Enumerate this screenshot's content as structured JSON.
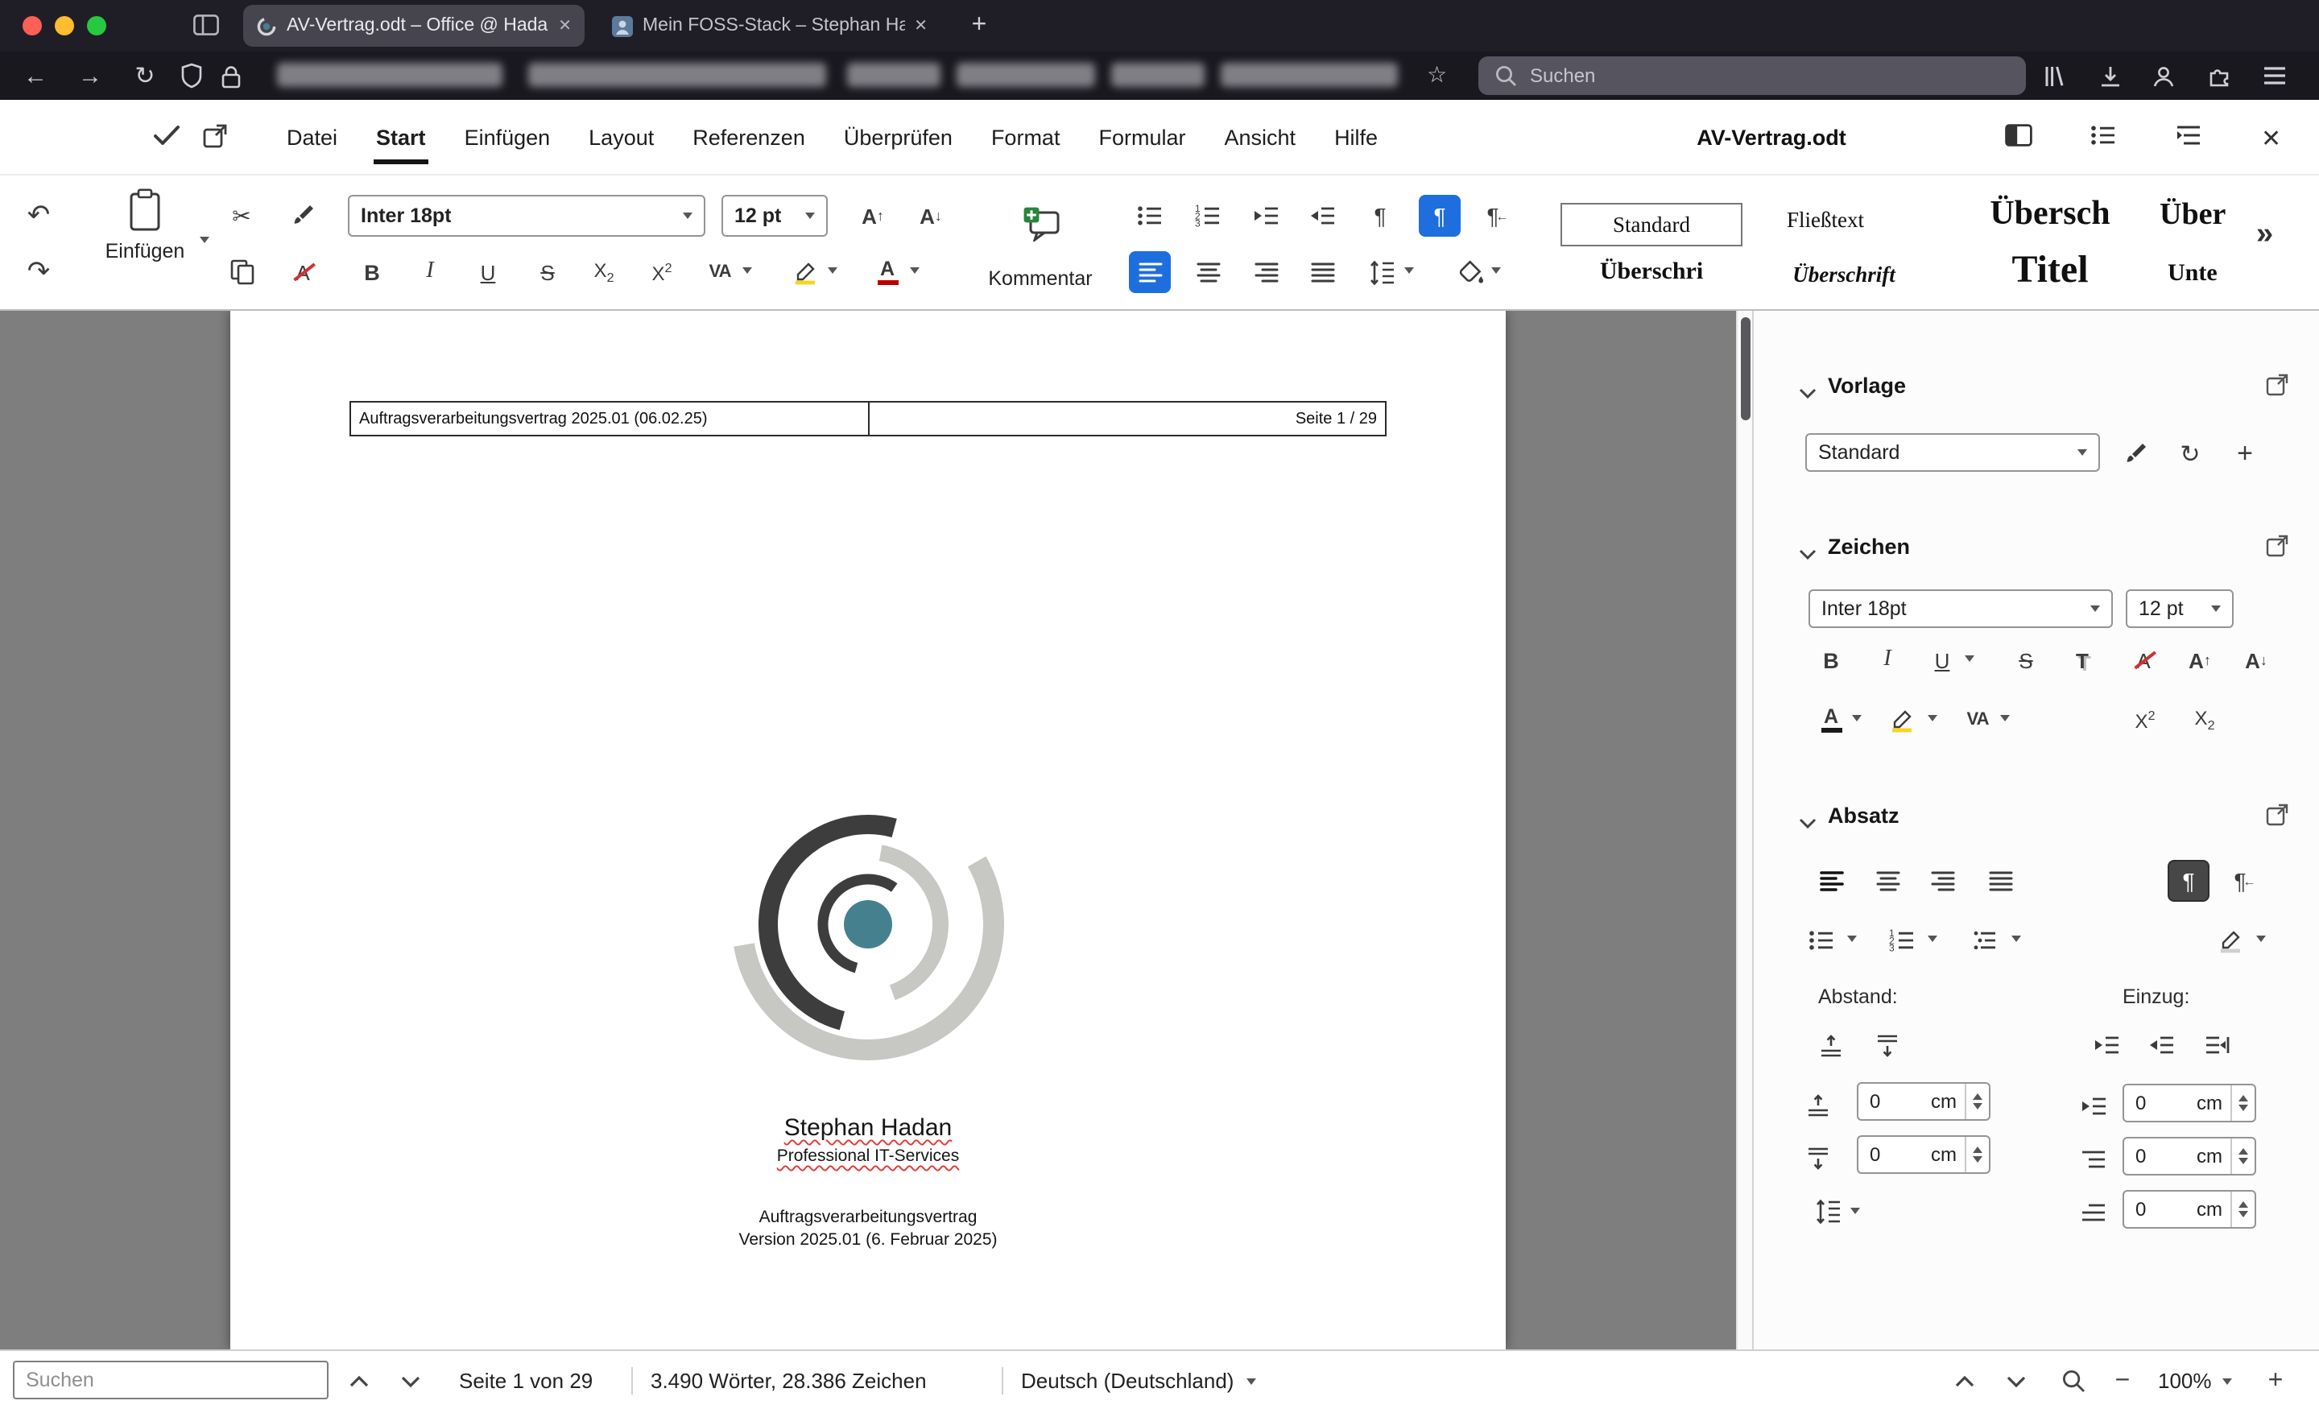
{
  "colors": {
    "accent": "#1e6ede",
    "teal": "#45808e"
  },
  "browser": {
    "tabs": [
      {
        "title": "AV-Vertrag.odt – Office @ Hada"
      },
      {
        "title": "Mein FOSS-Stack – Stephan Ha"
      }
    ],
    "search_placeholder": "Suchen"
  },
  "app": {
    "menu": [
      "Datei",
      "Start",
      "Einfügen",
      "Layout",
      "Referenzen",
      "Überprüfen",
      "Format",
      "Formular",
      "Ansicht",
      "Hilfe"
    ],
    "doc_title": "AV-Vertrag.odt"
  },
  "toolbar": {
    "paste_label": "Einfügen",
    "font_name": "Inter 18pt",
    "font_size": "12 pt",
    "comment_label": "Kommentar",
    "styles": [
      "Standard",
      "Fließtext",
      "Übersch",
      "Über",
      "Überschri",
      "Überschrift",
      "Titel",
      "Unte"
    ]
  },
  "sidebar": {
    "vorlage_title": "Vorlage",
    "vorlage_value": "Standard",
    "zeichen_title": "Zeichen",
    "font_name": "Inter 18pt",
    "font_size": "12 pt",
    "absatz_title": "Absatz",
    "abstand_label": "Abstand:",
    "einzug_label": "Einzug:",
    "spacing": [
      {
        "value": "0",
        "unit": "cm"
      },
      {
        "value": "0",
        "unit": "cm"
      }
    ],
    "indent": [
      {
        "value": "0",
        "unit": "cm"
      },
      {
        "value": "0",
        "unit": "cm"
      },
      {
        "value": "0",
        "unit": "cm"
      }
    ]
  },
  "document": {
    "header_left": "Auftragsverarbeitungsvertrag 2025.01 (06.02.25)",
    "header_right": "Seite 1 / 29",
    "name": "Stephan Hadan",
    "tagline": "Professional IT-Services",
    "title_line1": "Auftragsverarbeitungsvertrag",
    "title_line2": "Version 2025.01 (6. Februar 2025)"
  },
  "status": {
    "search_placeholder": "Suchen",
    "page_info": "Seite 1 von 29",
    "word_count": "3.490 Wörter, 28.386 Zeichen",
    "language": "Deutsch (Deutschland)",
    "zoom": "100%"
  }
}
